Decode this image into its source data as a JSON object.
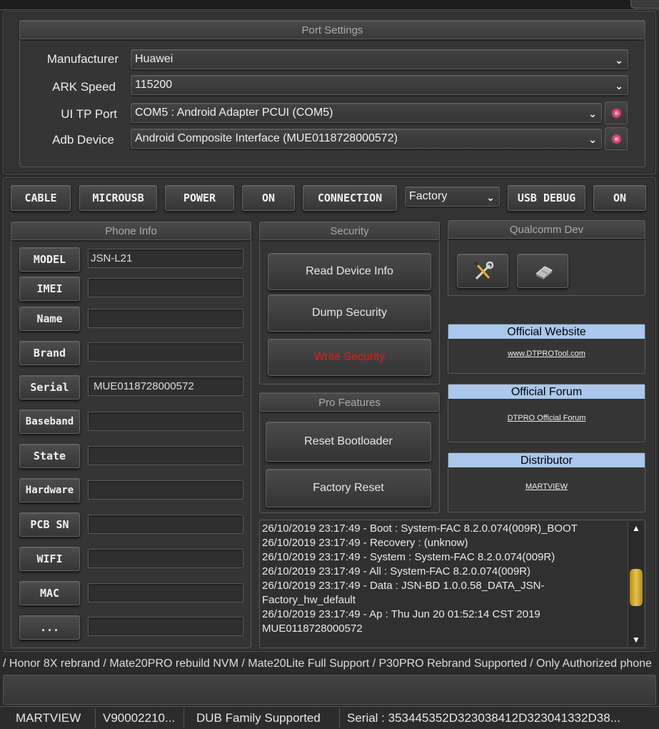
{
  "port_settings": {
    "title": "Port Settings",
    "manufacturer": {
      "label": "Manufacturer",
      "value": "Huawei"
    },
    "ark_speed": {
      "label": "ARK Speed",
      "value": "115200"
    },
    "ui_tp_port": {
      "label": "UI TP Port",
      "value": "COM5 : Android Adapter PCUI (COM5)"
    },
    "adb_device": {
      "label": "Adb Device",
      "value": "Android Composite Interface (MUE0118728000572)"
    }
  },
  "toolbar": {
    "cable": "CABLE",
    "microusb": "MICROUSB",
    "power": "POWER",
    "power_state": "ON",
    "connection": "CONNECTION",
    "connection_mode": "Factory",
    "usb_debug": "USB DEBUG",
    "usb_debug_state": "ON"
  },
  "phone_info": {
    "title": "Phone Info",
    "rows": [
      {
        "label": "MODEL",
        "value": "JSN-L21"
      },
      {
        "label": "IMEI",
        "value": ""
      },
      {
        "label": "Name",
        "value": ""
      },
      {
        "label": "Brand",
        "value": ""
      },
      {
        "label": "Serial",
        "value": "MUE0118728000572"
      },
      {
        "label": "Baseband",
        "value": ""
      },
      {
        "label": "State",
        "value": ""
      },
      {
        "label": "Hardware",
        "value": ""
      },
      {
        "label": "PCB SN",
        "value": ""
      },
      {
        "label": "WIFI",
        "value": ""
      },
      {
        "label": "MAC",
        "value": ""
      },
      {
        "label": "...",
        "value": ""
      }
    ]
  },
  "security": {
    "title": "Security",
    "read_device_info": "Read Device Info",
    "dump_security": "Dump Security",
    "write_security": "Write Security",
    "write_color": "#e01e1e"
  },
  "pro_features": {
    "title": "Pro Features",
    "reset_bootloader": "Reset Bootloader",
    "factory_reset": "Factory Reset"
  },
  "qualcomm": {
    "title": "Qualcomm Dev",
    "tool_icon": "wrench-screwdriver-icon",
    "chip_icon": "chip-icon"
  },
  "links": {
    "website": {
      "title": "Official Website",
      "text": "www.DTPROTool.com"
    },
    "forum": {
      "title": "Official Forum",
      "text": "DTPRO Official Forum"
    },
    "distributor": {
      "title": "Distributor",
      "text": "MARTVIEW"
    },
    "header_color": "#a9c8ec"
  },
  "log": {
    "lines": [
      "26/10/2019 23:17:49 - Boot : System-FAC 8.2.0.074(009R)_BOOT",
      "26/10/2019 23:17:49 - Recovery : (unknow)",
      "26/10/2019 23:17:49 - System : System-FAC 8.2.0.074(009R)",
      "26/10/2019 23:17:49 - All : System-FAC 8.2.0.074(009R)",
      "26/10/2019 23:17:49 - Data : JSN-BD 1.0.0.58_DATA_JSN-",
      "Factory_hw_default",
      "26/10/2019 23:17:49 - Ap : Thu Jun 20 01:52:14 CST 2019",
      "MUE0118728000572"
    ]
  },
  "ticker": "/  Honor 8X rebrand /  Mate20PRO rebuild NVM /  Mate20Lite Full Support /  P30PRO Rebrand Supported /  Only Authorized phone",
  "status_bar": {
    "distributor": "MARTVIEW",
    "version": "V90002210...",
    "family": "DUB Family Supported",
    "serial": "Serial : 353445352D323038412D323041332D38..."
  }
}
